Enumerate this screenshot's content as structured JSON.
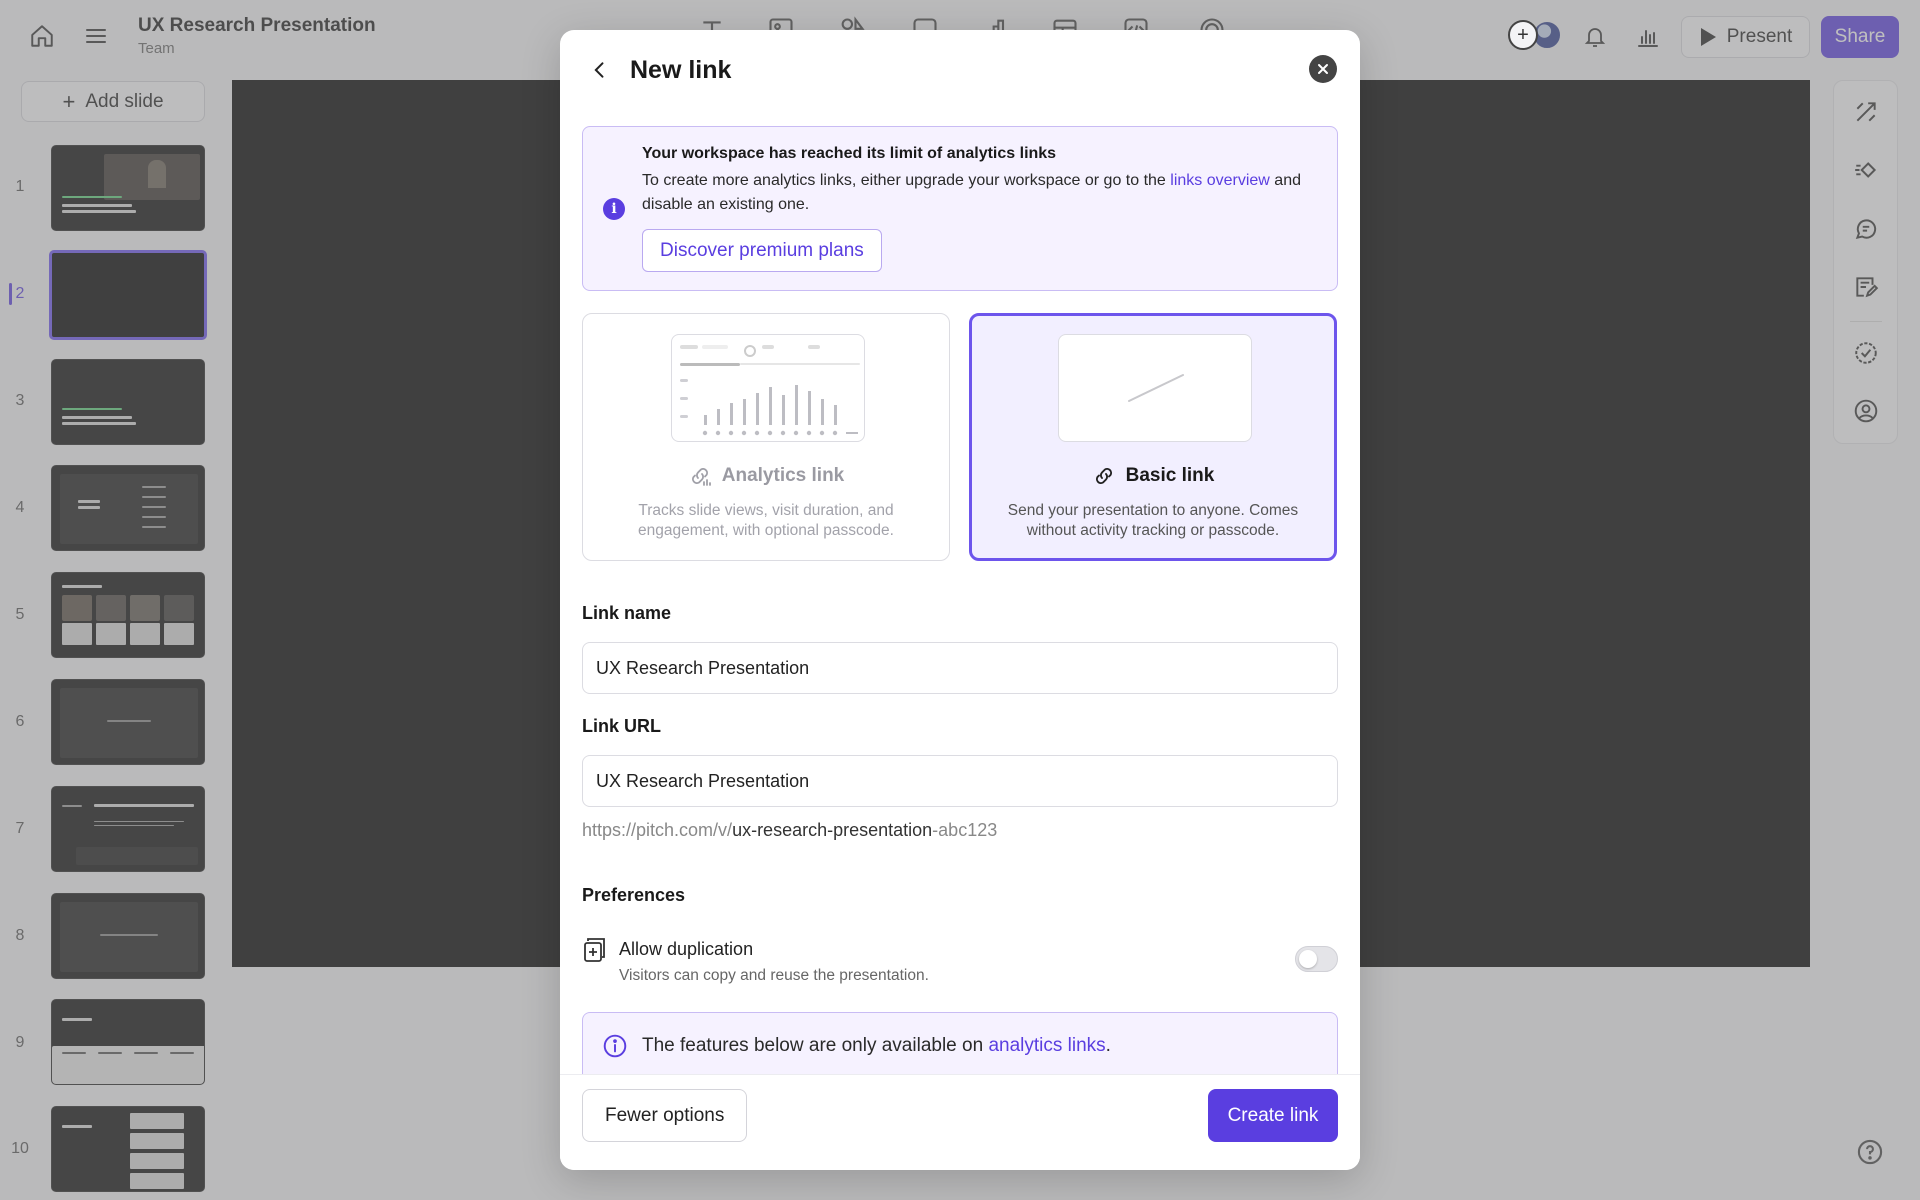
{
  "header": {
    "doc_title": "UX Research Presentation",
    "doc_subtitle": "Team",
    "present_label": "Present",
    "share_label": "Share"
  },
  "toolbar": {
    "tools": [
      "text-icon",
      "image-icon",
      "shapes-icon",
      "rectangle-icon",
      "chart-icon",
      "table-icon",
      "embed-icon",
      "record-icon"
    ]
  },
  "sidebar": {
    "add_slide_label": "Add slide",
    "active_slide": 2,
    "slides": [
      "1",
      "2",
      "3",
      "4",
      "5",
      "6",
      "7",
      "8",
      "9",
      "10"
    ]
  },
  "right_rail": {
    "icons": [
      "design-icon",
      "animation-icon",
      "comments-icon",
      "notes-icon",
      "check-icon",
      "profile-icon"
    ]
  },
  "modal": {
    "title": "New link",
    "notice": {
      "heading": "Your workspace has reached its limit of analytics links",
      "body_before": "To create more analytics links, either upgrade your workspace or go to the ",
      "body_link": "links overview",
      "body_after": " and disable an existing one.",
      "button": "Discover premium plans"
    },
    "options": {
      "analytics": {
        "label": "Analytics link",
        "desc": "Tracks slide views, visit duration, and engagement, with optional passcode."
      },
      "basic": {
        "label": "Basic link",
        "desc": "Send your presentation to anyone. Comes without activity tracking or passcode."
      },
      "selected": "basic"
    },
    "link_name": {
      "label": "Link name",
      "value": "UX Research Presentation"
    },
    "link_url": {
      "label": "Link URL",
      "value": "UX Research Presentation",
      "prefix": "https://pitch.com/v/",
      "slug": "ux-research-presentation",
      "suffix": "-abc123"
    },
    "preferences": {
      "title": "Preferences",
      "duplication": {
        "title": "Allow duplication",
        "desc": "Visitors can copy and reuse the presentation.",
        "enabled": false
      }
    },
    "analytics_info": {
      "before": "The features below are only available on ",
      "link": "analytics links",
      "after": "."
    },
    "footer": {
      "fewer_label": "Fewer options",
      "create_label": "Create link"
    }
  },
  "colors": {
    "accent": "#5a3ee0",
    "accent_light_bg": "#f6f2ff",
    "canvas": "#000000"
  }
}
